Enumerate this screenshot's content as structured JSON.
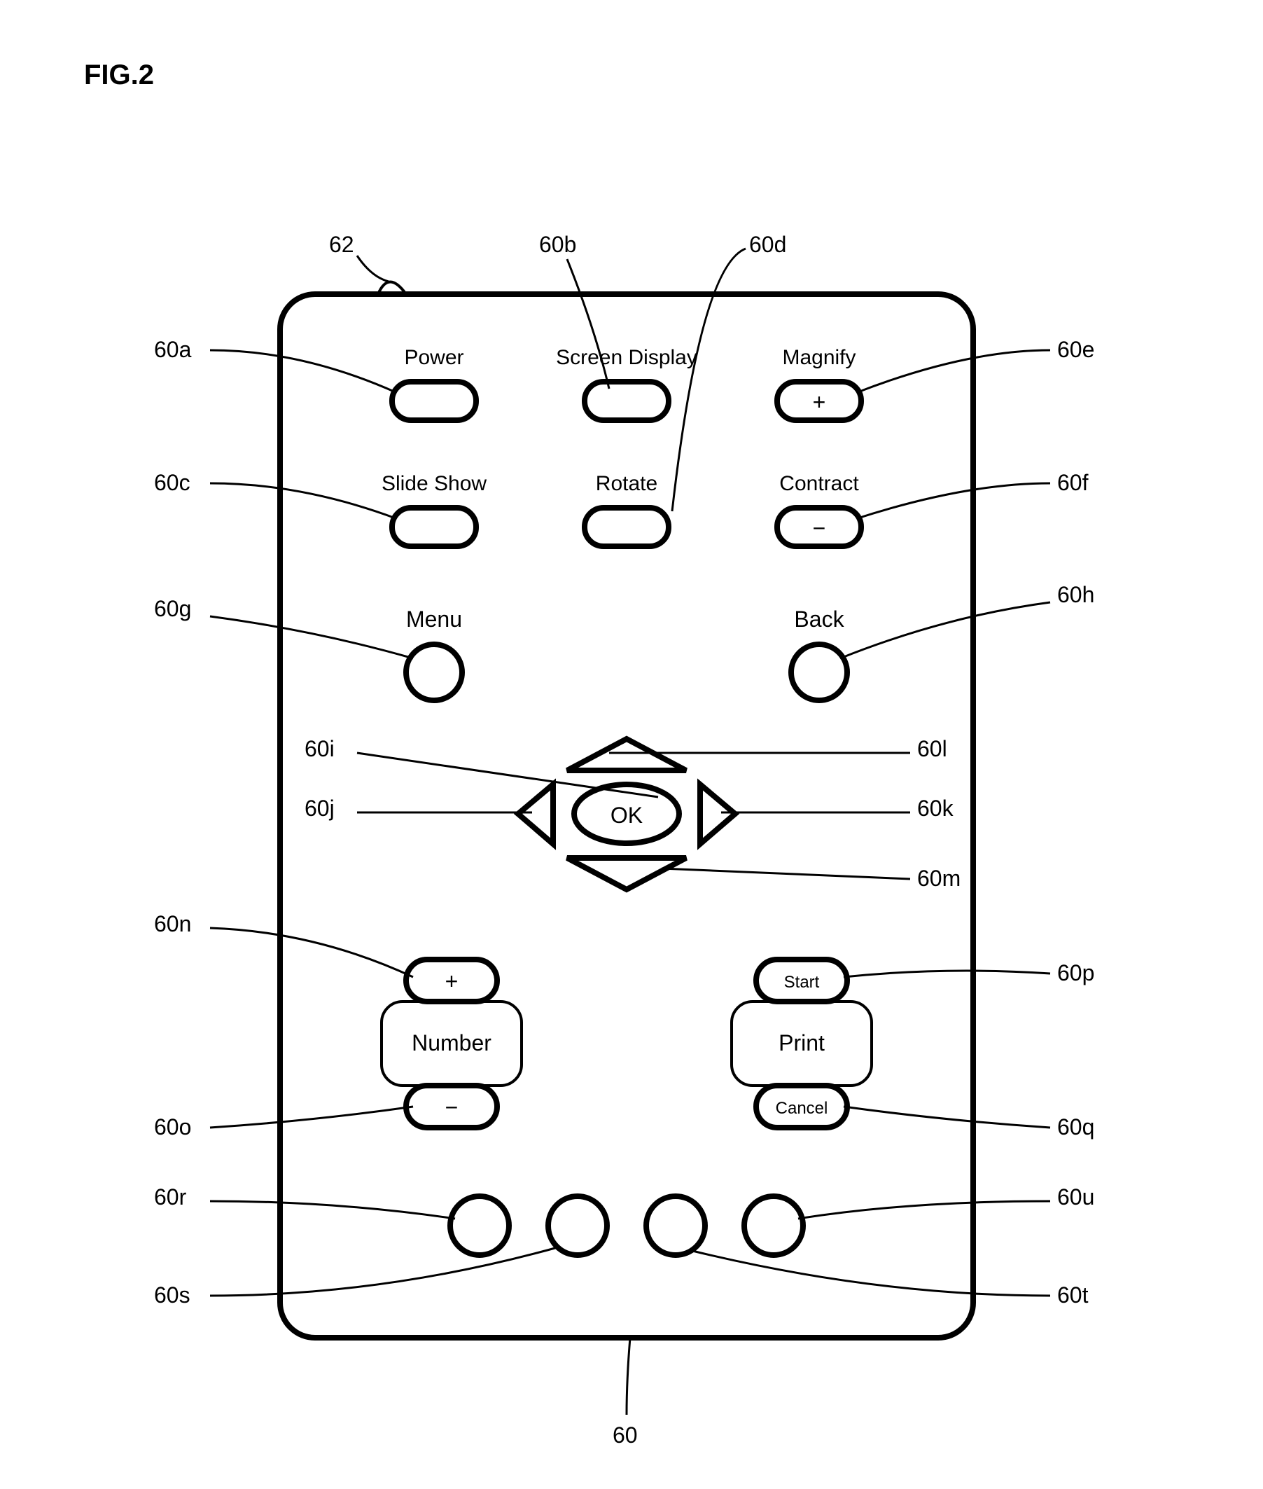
{
  "figure": "FIG.2",
  "labels": {
    "power": "Power",
    "screen": "Screen Display",
    "magnify": "Magnify",
    "slide": "Slide Show",
    "rotate": "Rotate",
    "contract": "Contract",
    "menu": "Menu",
    "back": "Back",
    "ok": "OK",
    "number": "Number",
    "print": "Print",
    "start": "Start",
    "cancel": "Cancel",
    "plus": "+",
    "minus": "−"
  },
  "refs": {
    "body": "60",
    "emitter": "62",
    "a": "60a",
    "b": "60b",
    "c": "60c",
    "d": "60d",
    "e": "60e",
    "f": "60f",
    "g": "60g",
    "h": "60h",
    "i": "60i",
    "j": "60j",
    "k": "60k",
    "l": "60l",
    "m": "60m",
    "n": "60n",
    "o": "60o",
    "p": "60p",
    "q": "60q",
    "r": "60r",
    "s": "60s",
    "t": "60t",
    "u": "60u"
  }
}
